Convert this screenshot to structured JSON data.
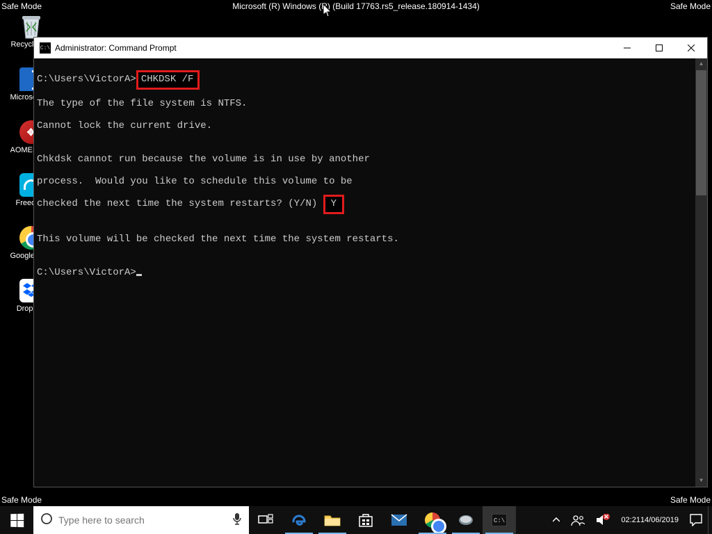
{
  "topbar": {
    "safe_mode": "Safe Mode",
    "build": "Microsoft (R) Windows (R) (Build 17763.rs5_release.180914-1434)"
  },
  "desktop": {
    "recycle": "Recycle Bin",
    "edge": "Microsoft Edge",
    "aomei": "AOMEI Partition",
    "freedom": "Freedom",
    "chrome": "Google Chrome",
    "dropbox": "Dropbox"
  },
  "cmd": {
    "title": "Administrator: Command Prompt",
    "prompt_path": "C:\\Users\\VictorA>",
    "chkdsk_cmd": "CHKDSK /F",
    "l2": "The type of the file system is NTFS.",
    "l3": "Cannot lock the current drive.",
    "l4": "",
    "l5": "Chkdsk cannot run because the volume is in use by another",
    "l6a": "process.  Would you like to schedule this volume to be",
    "l7a": "checked the next time the system restarts? (Y/N) ",
    "l7ans": "Y",
    "l8": "",
    "l9": "This volume will be checked the next time the system restarts.",
    "l10": "",
    "l11": "C:\\Users\\VictorA>"
  },
  "window_controls": {
    "minimize": "minimize",
    "maximize": "maximize",
    "close": "close"
  },
  "taskbar": {
    "search_placeholder": "Type here to search",
    "time": "02:21",
    "date": "14/06/2019"
  }
}
